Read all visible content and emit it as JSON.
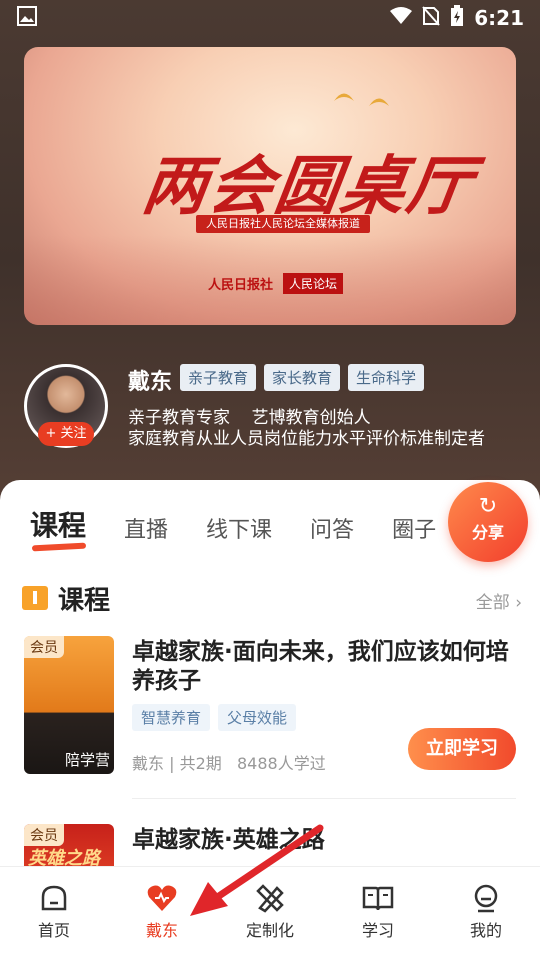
{
  "status": {
    "time": "6:21"
  },
  "banner": {
    "title": "两会圆桌厅",
    "ribbon": "人民日报社人民论坛全媒体报道",
    "logo1": "人民日报社",
    "logo2": "人民论坛"
  },
  "profile": {
    "name": "戴东",
    "follow_label": "+ 关注",
    "tags": [
      "亲子教育",
      "家长教育",
      "生命科学"
    ],
    "desc_line1": "亲子教育专家    艺博教育创始人",
    "desc_line2": "家庭教育从业人员岗位能力水平评价标准制定者"
  },
  "tabs": [
    "课程",
    "直播",
    "线下课",
    "问答",
    "圈子"
  ],
  "share_label": "分享",
  "section": {
    "title": "课程",
    "see_all": "全部 ›"
  },
  "courses": [
    {
      "badge": "会员",
      "thumb_caption": "陪学营",
      "title": "卓越家族·面向未来，我们应该如何培养孩子",
      "tags": [
        "智慧养育",
        "父母效能"
      ],
      "meta": "戴东 | 共2期   8488人学过",
      "button": "立即学习"
    },
    {
      "badge": "会员",
      "thumb_text": "英雄之路",
      "title": "卓越家族·英雄之路"
    }
  ],
  "nav": [
    {
      "label": "首页",
      "icon": "home-icon"
    },
    {
      "label": "戴东",
      "icon": "heart-icon",
      "active": true
    },
    {
      "label": "定制化",
      "icon": "pencil-ruler-icon"
    },
    {
      "label": "学习",
      "icon": "book-icon"
    },
    {
      "label": "我的",
      "icon": "profile-icon"
    }
  ],
  "colors": {
    "accent": "#e83d22",
    "tag_bg": "#eef4fa",
    "tag_text": "#5a7fa6"
  }
}
